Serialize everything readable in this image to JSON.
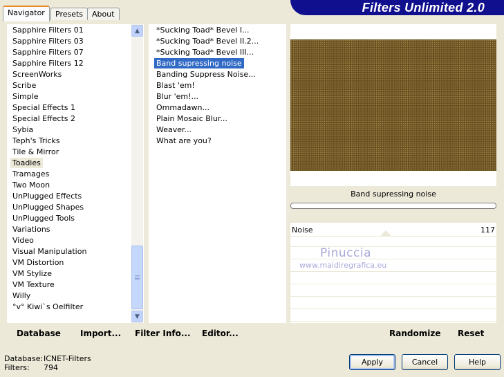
{
  "tabs": [
    {
      "label": "Navigator",
      "active": true
    },
    {
      "label": "Presets",
      "active": false
    },
    {
      "label": "About",
      "active": false
    }
  ],
  "banner": {
    "title": "Filters Unlimited 2.0"
  },
  "categories": [
    "Sapphire Filters 01",
    "Sapphire Filters 03",
    "Sapphire Filters 07",
    "Sapphire Filters 12",
    "ScreenWorks",
    "Scribe",
    "Simple",
    "Special Effects 1",
    "Special Effects 2",
    "Sybia",
    "Teph's Tricks",
    "Tile & Mirror",
    "Toadies",
    "Tramages",
    "Two Moon",
    "UnPlugged Effects",
    "UnPlugged Shapes",
    "UnPlugged Tools",
    "Variations",
    "Video",
    "Visual Manipulation",
    "VM Distortion",
    "VM Stylize",
    "VM Texture",
    "Willy",
    "°v° Kiwi`s Oelfilter"
  ],
  "selected_category": "Toadies",
  "filters": [
    "*Sucking Toad*  Bevel I...",
    "*Sucking Toad*  Bevel II.2...",
    "*Sucking Toad*  Bevel III...",
    "Band supressing noise",
    "Banding Suppress Noise...",
    "Blast 'em!",
    "Blur 'em!...",
    "Ommadawn...",
    "Plain Mosaic Blur...",
    "Weaver...",
    "What are you?"
  ],
  "selected_filter": "Band supressing noise",
  "left_bar": {
    "database": "Database",
    "import": "Import...",
    "filter_info": "Filter Info...",
    "editor": "Editor..."
  },
  "right_bar": {
    "randomize": "Randomize",
    "reset": "Reset"
  },
  "current_filter_name": "Band supressing noise",
  "params": [
    {
      "label": "Noise",
      "value": "117"
    }
  ],
  "watermark": {
    "name": "Pinuccia",
    "site": "www.maidiregrafica.eu"
  },
  "info": {
    "database_label": "Database:",
    "database_value": "ICNET-Filters",
    "filters_label": "Filters:",
    "filters_value": "794"
  },
  "buttons": {
    "apply": "Apply",
    "cancel": "Cancel",
    "help": "Help"
  },
  "colors": {
    "banner": "#10108e",
    "selection": "#316ac5",
    "preview": "#6f5523"
  },
  "icons": {
    "scroll_up": "chevron-up-icon",
    "scroll_down": "chevron-down-icon"
  }
}
